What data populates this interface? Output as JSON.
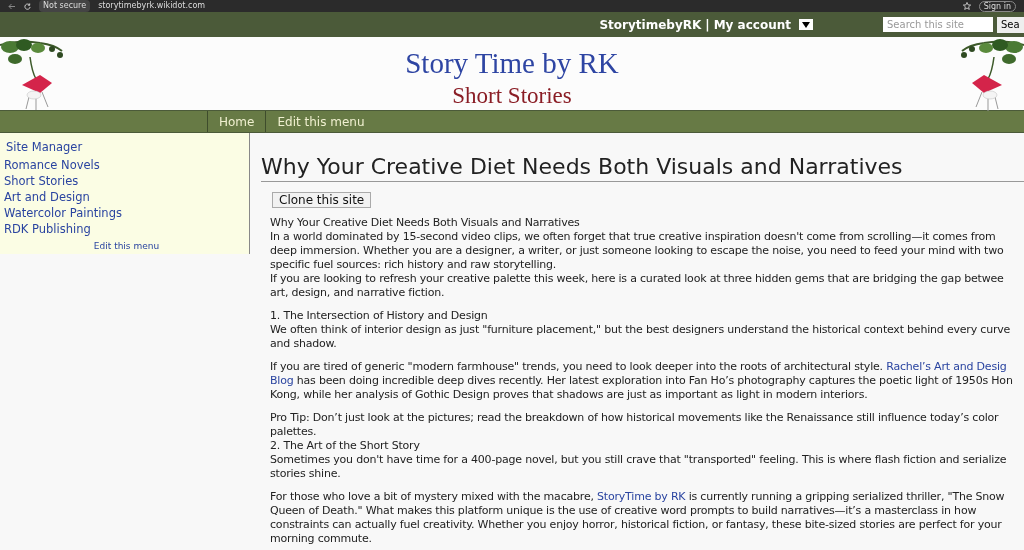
{
  "browser": {
    "security": "Not secure",
    "url": "storytimebyrk.wikidot.com",
    "sign_in": "Sign in"
  },
  "top_bar": {
    "site_user": "StorytimebyRK",
    "separator": "|",
    "account": "My account",
    "search_placeholder": "Search this site",
    "search_button": "Sea"
  },
  "header": {
    "title": "Story Time by RK",
    "subtitle": "Short Stories"
  },
  "nav": [
    {
      "label": "Home"
    },
    {
      "label": "Edit this menu"
    }
  ],
  "sidebar": {
    "items": [
      {
        "label": "Site Manager"
      },
      {
        "label": "Romance Novels"
      },
      {
        "label": "Short Stories"
      },
      {
        "label": "Art and Design"
      },
      {
        "label": "Watercolor Paintings"
      },
      {
        "label": "RDK Publishing"
      }
    ],
    "edit": "Edit this menu"
  },
  "page": {
    "title": "Why Your Creative Diet Needs Both Visuals and Narratives",
    "clone_button": "Clone this site",
    "paragraphs": [
      {
        "lines": [
          [
            {
              "text": "Why Your Creative Diet Needs Both Visuals and Narratives"
            }
          ],
          [
            {
              "text": "In a world dominated by 15-second video clips, we often forget that true creative inspiration doesn't come from scrolling—it comes from"
            }
          ],
          [
            {
              "text": "deep immersion. Whether you are a designer, a writer, or just someone looking to escape the noise, you need to feed your mind with two"
            }
          ],
          [
            {
              "text": "specific fuel sources: rich history and raw storytelling."
            }
          ],
          [
            {
              "text": "If you are looking to refresh your creative palette this week, here is a curated look at three hidden gems that are bridging the gap betwee"
            }
          ],
          [
            {
              "text": "art, design, and narrative fiction."
            }
          ]
        ]
      },
      {
        "lines": [
          [
            {
              "text": "1. The Intersection of History and Design"
            }
          ],
          [
            {
              "text": "We often think of interior design as just \"furniture placement,\" but the best designers understand the historical context behind every curve"
            }
          ],
          [
            {
              "text": "and shadow."
            }
          ]
        ]
      },
      {
        "lines": [
          [
            {
              "text": "If you are tired of generic \"modern farmhouse\" trends, you need to look deeper into the roots of architectural style. "
            },
            {
              "text": "Rachel’s Art and Desig",
              "kind": "link"
            }
          ],
          [
            {
              "text": "Blog",
              "kind": "link"
            },
            {
              "text": " has been doing incredible deep dives recently. Her latest exploration into Fan Ho’s photography captures the poetic light of 1950s Hon"
            }
          ],
          [
            {
              "text": "Kong, while her analysis of Gothic Design proves that shadows are just as important as light in modern interiors."
            }
          ]
        ]
      },
      {
        "lines": [
          [
            {
              "text": "Pro Tip: Don’t just look at the pictures; read the breakdown of how historical movements like the Renaissance still influence today’s color"
            }
          ],
          [
            {
              "text": "palettes."
            }
          ],
          [
            {
              "text": "2. The Art of the Short Story"
            }
          ],
          [
            {
              "text": "Sometimes you don't have time for a 400-page novel, but you still crave that \"transported\" feeling. This is where flash fiction and serialize"
            }
          ],
          [
            {
              "text": "stories shine."
            }
          ]
        ]
      },
      {
        "lines": [
          [
            {
              "text": "For those who love a bit of mystery mixed with the macabre, "
            },
            {
              "text": "StoryTime by RK",
              "kind": "link"
            },
            {
              "text": " is currently running a gripping serialized thriller, \"The Snow"
            }
          ],
          [
            {
              "text": "Queen of Death.\" What makes this platform unique is the use of creative word prompts to build narratives—it’s a masterclass in how"
            }
          ],
          [
            {
              "text": "constraints can actually fuel creativity. Whether you enjoy horror, historical fiction, or fantasy, these bite-sized stories are perfect for your"
            }
          ],
          [
            {
              "text": "morning commute."
            }
          ]
        ]
      }
    ]
  }
}
